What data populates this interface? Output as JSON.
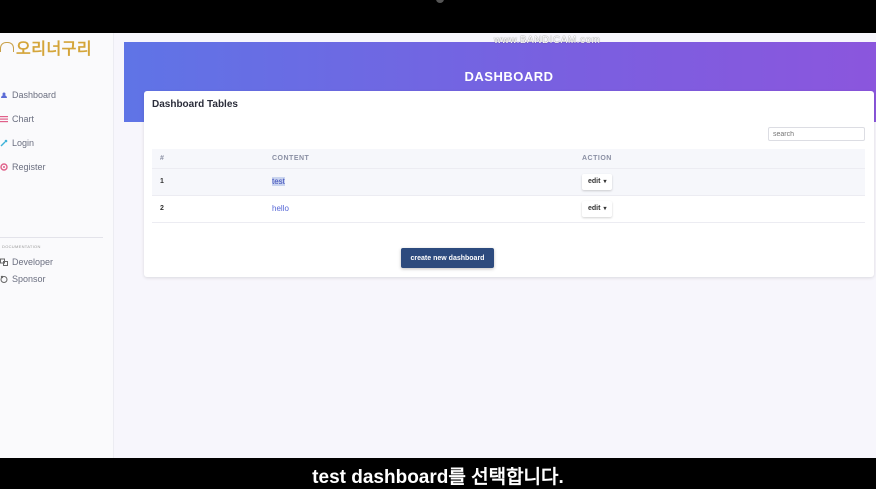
{
  "watermark": "www.BANDICAM.com",
  "brand": {
    "name": "오리너구리"
  },
  "sidebar": {
    "items": [
      {
        "label": "Dashboard",
        "icon": "dashboard-icon",
        "color": "#5b6bd6"
      },
      {
        "label": "Chart",
        "icon": "chart-icon",
        "color": "#e0608a"
      },
      {
        "label": "Login",
        "icon": "login-icon",
        "color": "#3fb3d9"
      },
      {
        "label": "Register",
        "icon": "register-icon",
        "color": "#e0608a"
      }
    ],
    "section_label": "DOCUMENTATION",
    "doc_items": [
      {
        "label": "Developer",
        "icon": "developer-icon"
      },
      {
        "label": "Sponsor",
        "icon": "sponsor-icon"
      }
    ]
  },
  "header": {
    "title": "DASHBOARD"
  },
  "card": {
    "title": "Dashboard Tables",
    "search_placeholder": "search",
    "columns": [
      "#",
      "CONTENT",
      "ACTION"
    ],
    "rows": [
      {
        "num": "1",
        "content": "test",
        "action": "edit"
      },
      {
        "num": "2",
        "content": "hello",
        "action": "edit"
      }
    ],
    "create_button": "create new dashboard"
  },
  "subtitle": "test dashboard를 선택합니다.",
  "colors": {
    "hero_start": "#5f74e6",
    "hero_end": "#8b56dd",
    "button": "#2d4b7e",
    "brand": "#d4a53a"
  }
}
